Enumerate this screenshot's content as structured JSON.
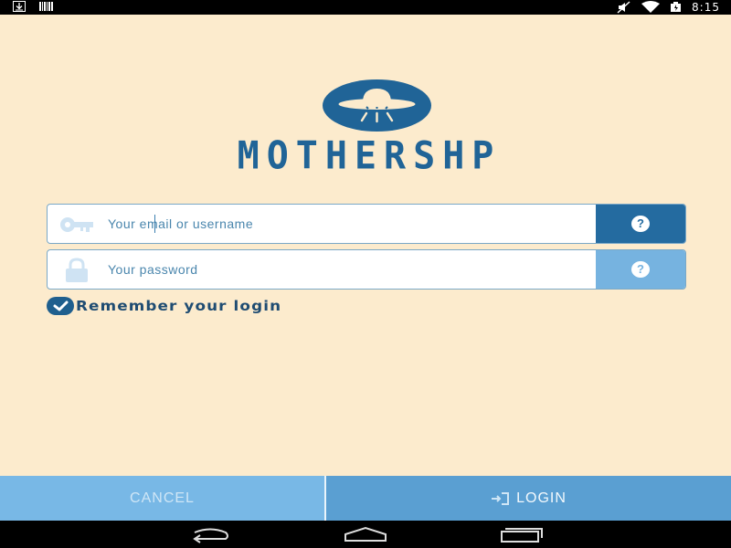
{
  "status_bar": {
    "time": "8:15",
    "left_icons": [
      "download-icon",
      "barcode-icon"
    ],
    "right_icons": [
      "mute-icon",
      "wifi-icon",
      "battery-icon"
    ]
  },
  "brand": {
    "name": "MOTHERSHP",
    "logo_icon": "ufo-icon",
    "color": "#206497"
  },
  "form": {
    "email_placeholder": "Your email or username",
    "email_value": "",
    "password_placeholder": "Your password",
    "password_value": "",
    "help_symbol": "?",
    "email_icon": "key-icon",
    "password_icon": "lock-icon",
    "remember_label": "Remember your login",
    "remember_checked": true
  },
  "actions": {
    "cancel_label": "CANCEL",
    "login_label": "LOGIN",
    "login_icon": "sign-in-icon"
  },
  "nav_bar": {
    "buttons": [
      "back-icon",
      "home-icon",
      "recent-apps-icon"
    ]
  },
  "colors": {
    "background": "#fcebcd",
    "primary_dark": "#246ba0",
    "primary_light": "#76b3e0",
    "cancel_bg": "#78b8e6",
    "login_bg": "#5a9fd2"
  }
}
